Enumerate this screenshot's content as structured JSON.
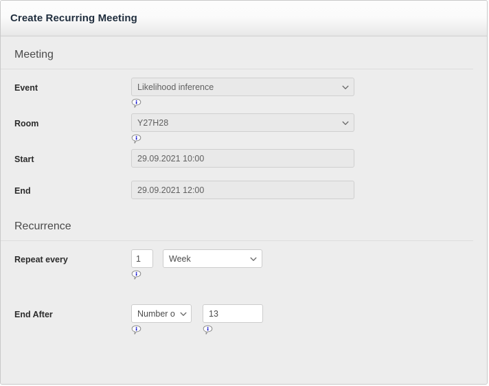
{
  "window": {
    "title": "Create Recurring Meeting"
  },
  "sections": {
    "meeting": {
      "title": "Meeting",
      "fields": {
        "event": {
          "label": "Event",
          "value": "Likelihood inference",
          "control": "select",
          "state": "disabled",
          "info_icon": "info-bubble-icon"
        },
        "room": {
          "label": "Room",
          "value": "Y27H28",
          "control": "select",
          "state": "disabled",
          "info_icon": "info-bubble-icon"
        },
        "start": {
          "label": "Start",
          "value": "29.09.2021 10:00",
          "control": "text",
          "state": "disabled"
        },
        "end": {
          "label": "End",
          "value": "29.09.2021 12:00",
          "control": "text",
          "state": "disabled"
        }
      }
    },
    "recurrence": {
      "title": "Recurrence",
      "fields": {
        "repeat_every": {
          "label": "Repeat every",
          "interval_value": "1",
          "unit_value": "Week",
          "info_icon": "info-bubble-icon"
        },
        "end_after": {
          "label": "End After",
          "type_value": "Number o",
          "count_value": "13",
          "info_icon_type": "info-bubble-icon",
          "info_icon_count": "info-bubble-icon"
        }
      }
    }
  },
  "colors": {
    "dialog_bg": "#ededed",
    "titlebar_top": "#fcfcfc",
    "titlebar_bottom": "#e7e7e7",
    "title_text": "#1f2d3d",
    "section_text": "#4a4a4a",
    "label_text": "#2b2b2b",
    "input_border": "#cccccc",
    "input_disabled_bg": "#e9e9e9",
    "info_icon_blue": "#1414cf"
  }
}
